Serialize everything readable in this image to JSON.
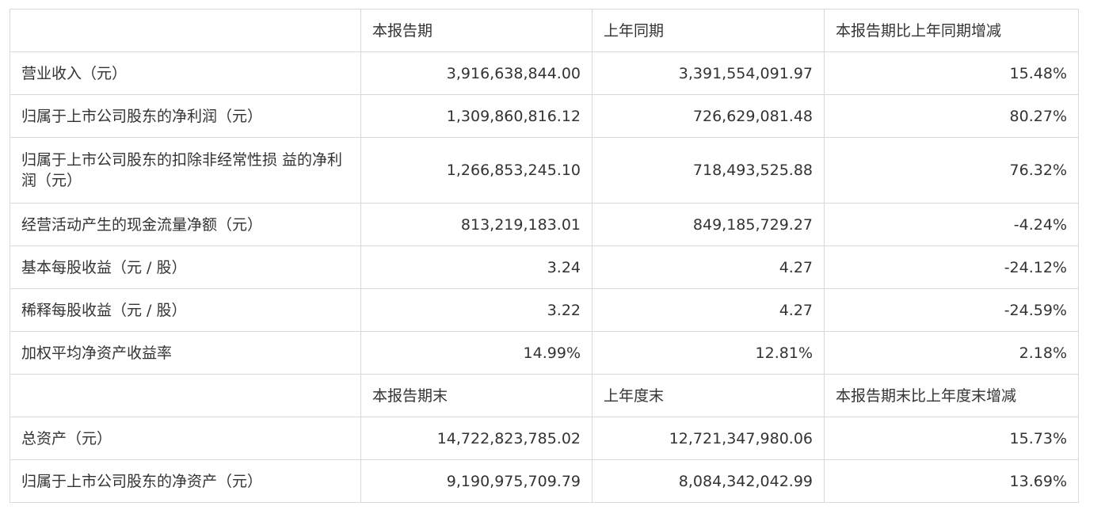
{
  "table": {
    "header1": [
      "",
      "本报告期",
      "上年同期",
      "本报告期比上年同期增减"
    ],
    "rows1": [
      [
        "营业收入（元）",
        "3,916,638,844.00",
        "3,391,554,091.97",
        "15.48%"
      ],
      [
        "归属于上市公司股东的净利润（元）",
        "1,309,860,816.12",
        "726,629,081.48",
        "80.27%"
      ],
      [
        "归属于上市公司股东的扣除非经常性损 益的净利润（元）",
        "1,266,853,245.10",
        "718,493,525.88",
        "76.32%"
      ],
      [
        "经营活动产生的现金流量净额（元）",
        "813,219,183.01",
        "849,185,729.27",
        "-4.24%"
      ],
      [
        "基本每股收益（元 / 股）",
        "3.24",
        "4.27",
        "-24.12%"
      ],
      [
        "稀释每股收益（元 / 股）",
        "3.22",
        "4.27",
        "-24.59%"
      ],
      [
        "加权平均净资产收益率",
        "14.99%",
        "12.81%",
        "2.18%"
      ]
    ],
    "header2": [
      "",
      "本报告期末",
      "上年度末",
      "本报告期末比上年度末增减"
    ],
    "rows2": [
      [
        "总资产（元）",
        "14,722,823,785.02",
        "12,721,347,980.06",
        "15.73%"
      ],
      [
        "归属于上市公司股东的净资产（元）",
        "9,190,975,709.79",
        "8,084,342,042.99",
        "13.69%"
      ]
    ]
  }
}
